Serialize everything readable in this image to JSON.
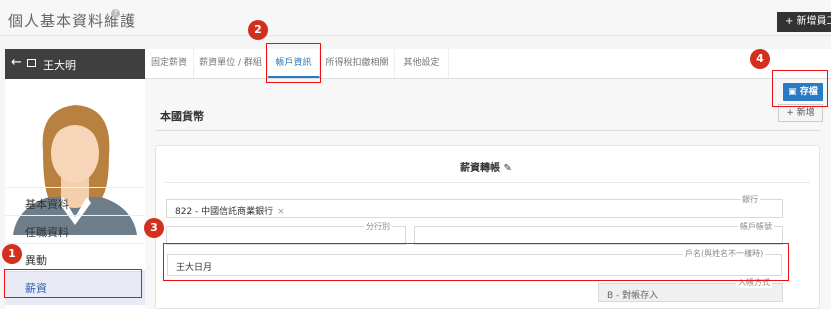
{
  "page": {
    "title": "個人基本資料維護",
    "new_employee_label": "+ 新增員工"
  },
  "employee": {
    "name": "王大明"
  },
  "sidebar": {
    "items": [
      {
        "label": "基本資料"
      },
      {
        "label": "任職資料"
      },
      {
        "label": "異動"
      },
      {
        "label": "薪資"
      }
    ]
  },
  "tabs": [
    {
      "label": "固定薪資"
    },
    {
      "label": "薪資單位 / 群組"
    },
    {
      "label": "帳戶資訊"
    },
    {
      "label": "所得稅扣繳相關"
    },
    {
      "label": "其他設定"
    }
  ],
  "toolbar": {
    "save_label": "存檔",
    "add_label": "+ 新增"
  },
  "section": {
    "title": "本國貨幣"
  },
  "card": {
    "title": "薪資轉帳",
    "fields": {
      "bank": {
        "label": "銀行",
        "value": "822 - 中國信託商業銀行"
      },
      "branch": {
        "label": "分行別",
        "value": ""
      },
      "account": {
        "label": "帳戶帳號",
        "value": ""
      },
      "account_name": {
        "label": "戶名(與姓名不一樣時)",
        "value": "王大日月"
      },
      "entry_type": {
        "label": "入帳方式",
        "value": "B - 對帳存入"
      }
    }
  },
  "callouts": [
    "1",
    "2",
    "3",
    "4"
  ],
  "colors": {
    "accent": "#2a7ac4",
    "highlight": "#e11111",
    "callout": "#d32f1e"
  }
}
